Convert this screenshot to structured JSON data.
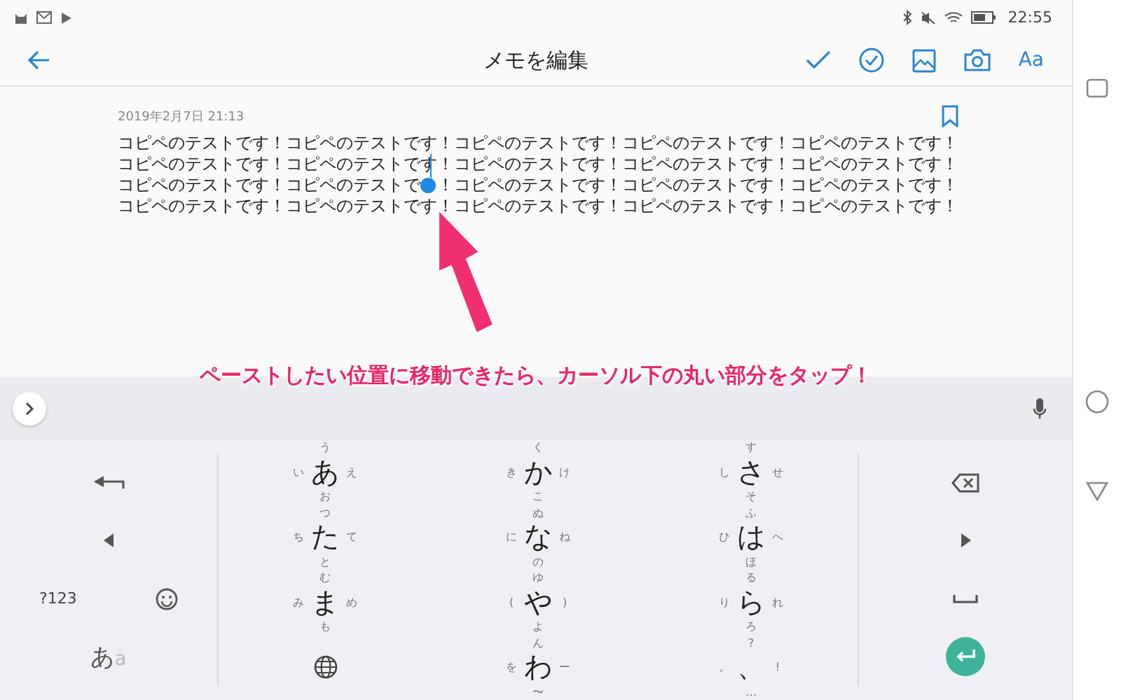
{
  "status_bar": {
    "time": "22:55"
  },
  "app_bar": {
    "title": "メモを編集",
    "font_button": "Aa"
  },
  "memo": {
    "date": "2019年2月7日 21:13",
    "lines": [
      [
        "コピペのテストです！コピペのテストです！コピペのテストです！コピペのテストです！コピペのテストです！"
      ],
      [
        "コピペのテストです！コピペのテストです！コピペのテストです！コピペのテストです！コピペのテストです！"
      ],
      [
        "コピペのテストです！コピペのテストで",
        "！コピペのテストです！コピペのテストです！コピペのテストです！"
      ],
      [
        "コピペのテストです！コピペのテストです！コピペのテストです！コピペのテストです！コピペのテストです！"
      ]
    ]
  },
  "annotation": {
    "caption": "ペーストしたい位置に移動できたら、カーソル下の丸い部分をタップ！"
  },
  "keyboard": {
    "mode_key": "?123",
    "kana_toggle": {
      "main": "あ",
      "sub": "a"
    },
    "rows": [
      [
        {
          "kind": "kana",
          "main": "あ",
          "top": "う",
          "left": "い",
          "right": "え",
          "bottom": "お"
        },
        {
          "kind": "kana",
          "main": "か",
          "top": "く",
          "left": "き",
          "right": "け",
          "bottom": "こ"
        },
        {
          "kind": "kana",
          "main": "さ",
          "top": "す",
          "left": "し",
          "right": "せ",
          "bottom": "そ"
        }
      ],
      [
        {
          "kind": "kana",
          "main": "た",
          "top": "つ",
          "left": "ち",
          "right": "て",
          "bottom": "と"
        },
        {
          "kind": "kana",
          "main": "な",
          "top": "ぬ",
          "left": "に",
          "right": "ね",
          "bottom": "の"
        },
        {
          "kind": "kana",
          "main": "は",
          "top": "ふ",
          "left": "ひ",
          "right": "へ",
          "bottom": "ほ"
        }
      ],
      [
        {
          "kind": "kana",
          "main": "ま",
          "top": "む",
          "left": "み",
          "right": "め",
          "bottom": "も"
        },
        {
          "kind": "kana",
          "main": "や",
          "top": "ゆ",
          "left": "(",
          "right": ")",
          "bottom": "よ"
        },
        {
          "kind": "kana",
          "main": "ら",
          "top": "る",
          "left": "り",
          "right": "れ",
          "bottom": "ろ"
        }
      ],
      [
        {
          "kind": "globe"
        },
        {
          "kind": "kana",
          "main": "わ",
          "top": "ん",
          "left": "を",
          "right": "ー",
          "bottom": "〜"
        },
        {
          "kind": "kana",
          "main": "、",
          "top": "?",
          "left": "。",
          "right": "!",
          "bottom": "…"
        }
      ]
    ]
  }
}
